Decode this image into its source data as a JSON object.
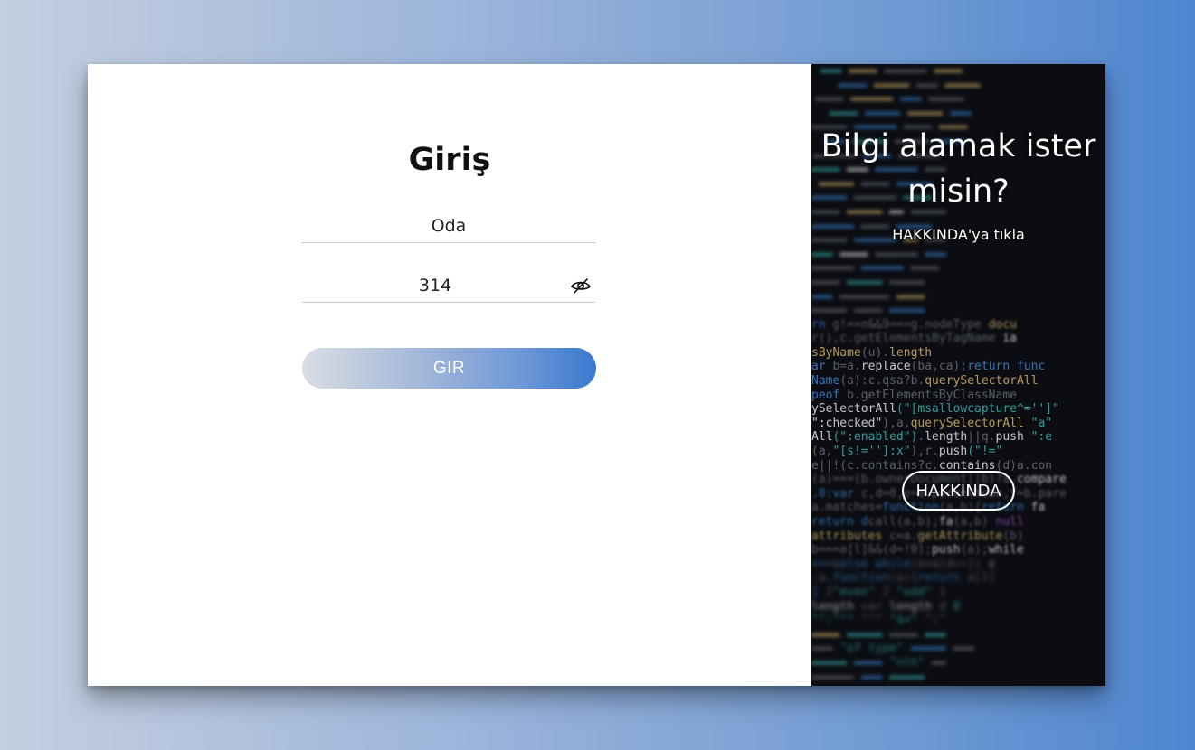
{
  "login": {
    "title": "Giriş",
    "room_placeholder": "Oda",
    "room_value": "",
    "code_value": "314",
    "submit_label": "GIR",
    "toggle_icon": "eye-off-icon"
  },
  "info_panel": {
    "title": "Bilgi alamak ister misin?",
    "subtitle": "HAKKINDA'ya tıkla",
    "about_label": "HAKKINDA"
  }
}
